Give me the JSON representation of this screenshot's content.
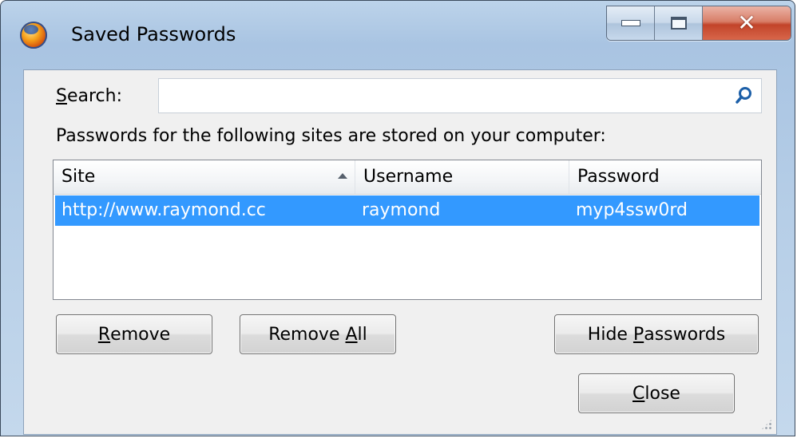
{
  "window": {
    "title": "Saved Passwords"
  },
  "search": {
    "label_prefix": "",
    "label_mnemonic": "S",
    "label_rest": "earch:",
    "value": ""
  },
  "info_text": "Passwords for the following sites are stored on your computer:",
  "table": {
    "columns": [
      "Site",
      "Username",
      "Password"
    ],
    "sorted_by": "Site",
    "rows": [
      {
        "site": "http://www.raymond.cc",
        "username": "raymond",
        "password": "myp4ssw0rd",
        "selected": true
      }
    ]
  },
  "buttons": {
    "remove": {
      "mnemonic": "R",
      "rest": "emove"
    },
    "remove_all": {
      "pre": "Remove ",
      "mnemonic": "A",
      "rest": "ll"
    },
    "hide_passwords": {
      "pre": "Hide ",
      "mnemonic": "P",
      "rest": "asswords"
    },
    "close": {
      "mnemonic": "C",
      "rest": "lose"
    }
  },
  "colors": {
    "selection": "#3399ff",
    "close_button": "#c2442a",
    "frame": "#b6cee7"
  },
  "icons": {
    "app": "firefox-icon",
    "search": "magnifier-icon",
    "minimize": "minimize-icon",
    "maximize": "maximize-icon",
    "close": "close-icon",
    "sort": "sort-ascending-icon",
    "grip": "resize-grip-icon"
  }
}
